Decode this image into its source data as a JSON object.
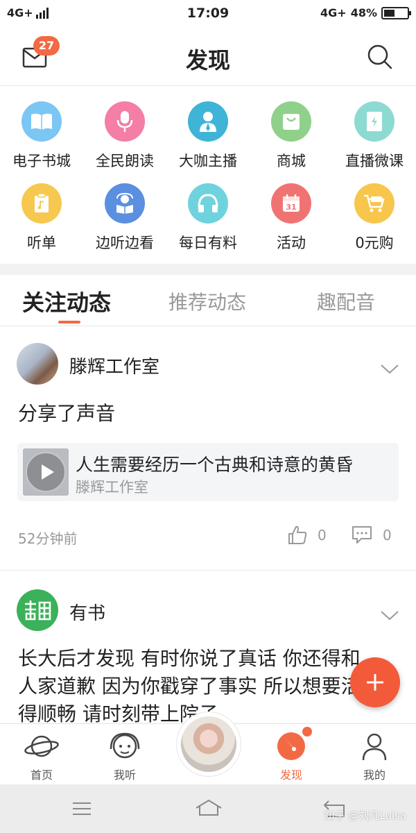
{
  "status_bar": {
    "network_left": "4G+",
    "time": "17:09",
    "network_right": "4G+",
    "battery": "48%",
    "battery_level": 0.48
  },
  "header": {
    "title": "发现",
    "mail_badge": "27",
    "mail_icon": "mail-icon",
    "search_icon": "search-icon"
  },
  "features": [
    {
      "label": "电子书城",
      "icon": "book-icon",
      "color": "#7cc6f4"
    },
    {
      "label": "全民朗读",
      "icon": "microphone-icon",
      "color": "#f47ea5"
    },
    {
      "label": "大咖主播",
      "icon": "anchor-person-icon",
      "color": "#3fb4d6"
    },
    {
      "label": "商城",
      "icon": "shopping-bag-icon",
      "color": "#8fd18a"
    },
    {
      "label": "直播微课",
      "icon": "live-class-icon",
      "color": "#8ddad3"
    },
    {
      "label": "听单",
      "icon": "playlist-icon",
      "color": "#f7c84f"
    },
    {
      "label": "边听边看",
      "icon": "reading-person-icon",
      "color": "#5b8fe0"
    },
    {
      "label": "每日有料",
      "icon": "headphones-icon",
      "color": "#6fd3de"
    },
    {
      "label": "活动",
      "icon": "calendar-icon",
      "color": "#f07373"
    },
    {
      "label": "0元购",
      "icon": "free-cart-icon",
      "color": "#f8c64c"
    }
  ],
  "tabs": [
    {
      "label": "关注动态",
      "active": true
    },
    {
      "label": "推荐动态",
      "active": false
    },
    {
      "label": "趣配音",
      "active": false
    }
  ],
  "post1": {
    "author": "滕辉工作室",
    "text": "分享了声音",
    "audio": {
      "title": "人生需要经历一个古典和诗意的黄昏",
      "subtitle": "滕辉工作室"
    },
    "time": "52分钟前",
    "likes": "0",
    "comments": "0"
  },
  "post2": {
    "author": "有书",
    "avatar_text": "有书",
    "text_line1": "长大后才发现 有时你说了真话 你还得和",
    "text_line2": "人家道歉 因为你戳穿了事实 所以想要活",
    "text_line3": "得顺畅 请时刻带上院子"
  },
  "bottom_nav": [
    {
      "label": "首页",
      "icon": "planet-icon",
      "active": false
    },
    {
      "label": "我听",
      "icon": "listen-face-icon",
      "active": false
    },
    {
      "label": "发现",
      "icon": "discover-compass-icon",
      "active": true
    },
    {
      "label": "我的",
      "icon": "user-icon",
      "active": false
    }
  ],
  "watermark": "知乎 @刘凡Luisa"
}
